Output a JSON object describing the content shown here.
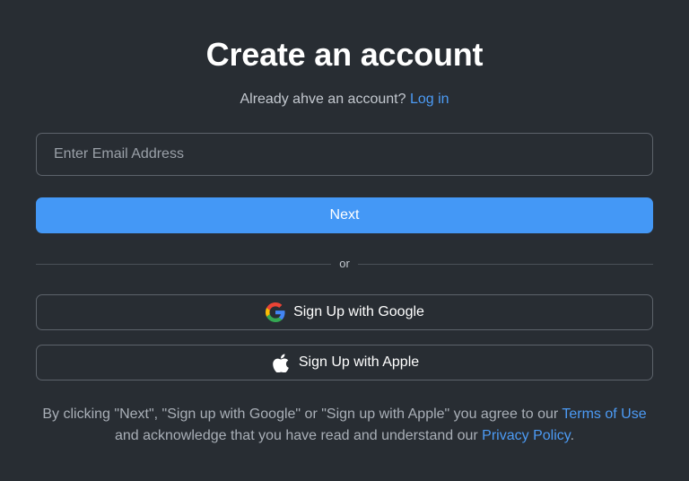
{
  "header": {
    "title": "Create an account",
    "subtitle_prefix": "Already ahve an account?",
    "login_link": "Log in"
  },
  "form": {
    "email_placeholder": "Enter Email Address",
    "email_value": "",
    "next_label": "Next",
    "divider_text": "or"
  },
  "social": {
    "google_label": "Sign Up with Google",
    "google_icon": "google-icon",
    "apple_label": "Sign Up with Apple",
    "apple_icon": "apple-icon"
  },
  "legal": {
    "text_1": "By clicking \"Next\", \"Sign up with Google\" or \"Sign up with Apple\" you agree to our",
    "terms_link": "Terms of Use",
    "text_2": "and acknowledge that you have read and understand our",
    "privacy_link": "Privacy Policy",
    "text_3": "."
  },
  "colors": {
    "background": "#282d33",
    "accent": "#4498f6",
    "link": "#4c9bf5",
    "border": "#5d636b"
  }
}
